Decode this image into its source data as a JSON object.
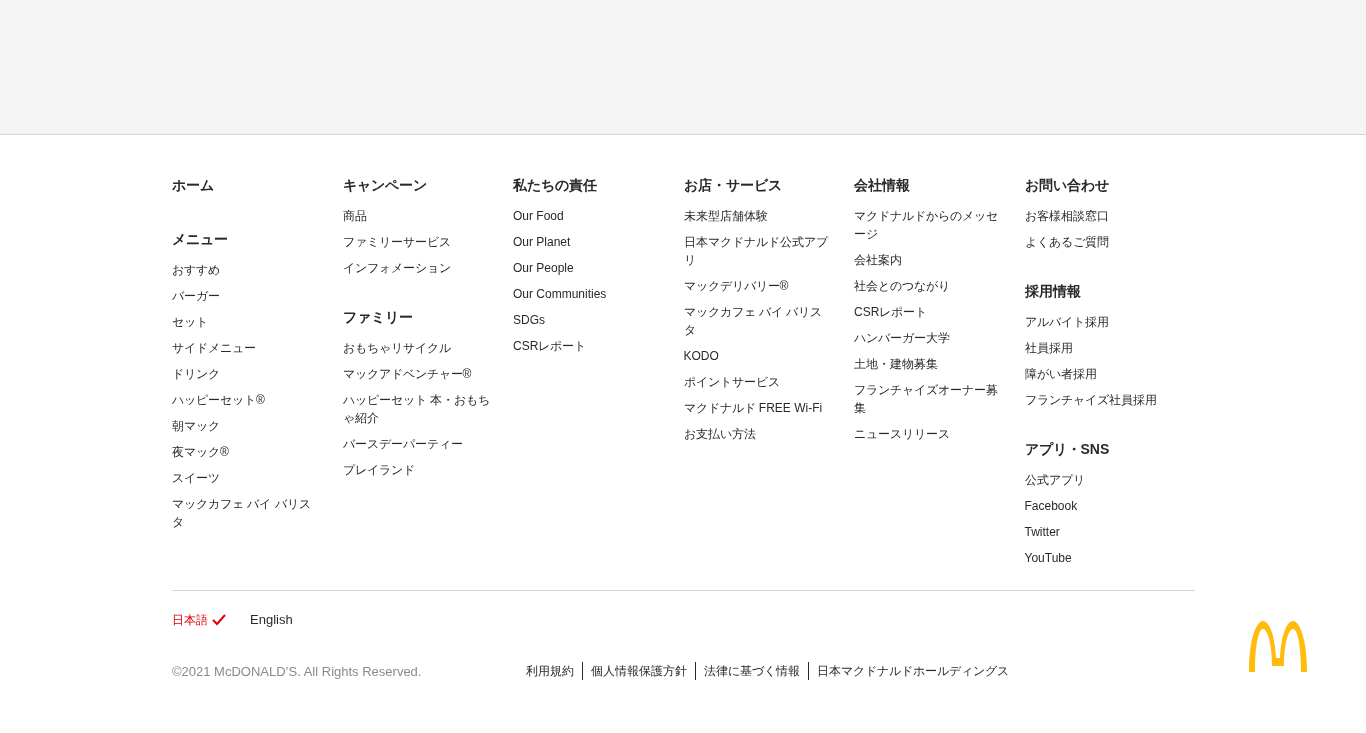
{
  "columns": [
    {
      "sections": [
        {
          "heading": "ホーム"
        },
        {
          "heading": "メニュー",
          "items": [
            "おすすめ",
            "バーガー",
            "セット",
            "サイドメニュー",
            "ドリンク",
            "ハッピーセット®",
            "朝マック",
            "夜マック®",
            "スイーツ",
            "マックカフェ バイ バリスタ"
          ]
        }
      ]
    },
    {
      "sections": [
        {
          "heading": "キャンペーン",
          "items": [
            "商品",
            "ファミリーサービス",
            "インフォメーション"
          ]
        },
        {
          "heading": "ファミリー",
          "items": [
            "おもちゃリサイクル",
            "マックアドベンチャー®",
            "ハッピーセット 本・おもちゃ紹介",
            "バースデーパーティー",
            "プレイランド"
          ]
        }
      ]
    },
    {
      "sections": [
        {
          "heading": "私たちの責任",
          "items": [
            "Our Food",
            "Our Planet",
            "Our People",
            "Our Communities",
            "SDGs",
            "CSRレポート"
          ]
        }
      ]
    },
    {
      "sections": [
        {
          "heading": "お店・サービス",
          "items": [
            "未来型店舗体験",
            "日本マクドナルド公式アプリ",
            "マックデリバリー®",
            "マックカフェ バイ バリスタ",
            "KODO",
            "ポイントサービス",
            "マクドナルド FREE Wi-Fi",
            "お支払い方法"
          ]
        }
      ]
    },
    {
      "sections": [
        {
          "heading": "会社情報",
          "items": [
            "マクドナルドからのメッセージ",
            "会社案内",
            "社会とのつながり",
            "CSRレポート",
            "ハンバーガー大学",
            "土地・建物募集",
            "フランチャイズオーナー募集",
            "ニュースリリース"
          ]
        }
      ]
    },
    {
      "sections": [
        {
          "heading": "お問い合わせ",
          "items": [
            "お客様相談窓口",
            "よくあるご質問"
          ]
        },
        {
          "heading": "採用情報",
          "items": [
            "アルバイト採用",
            "社員採用",
            "障がい者採用",
            "フランチャイズ社員採用"
          ]
        },
        {
          "heading": "アプリ・SNS",
          "items": [
            "公式アプリ",
            "Facebook",
            "Twitter",
            "YouTube"
          ]
        }
      ]
    }
  ],
  "languages": [
    {
      "label": "日本語",
      "selected": true
    },
    {
      "label": "English",
      "selected": false
    }
  ],
  "copyright": "©2021 McDONALD’S. All Rights Reserved.",
  "legal_links": [
    "利用規約",
    "個人情報保護方針",
    "法律に基づく情報",
    "日本マクドナルドホールディングス"
  ]
}
